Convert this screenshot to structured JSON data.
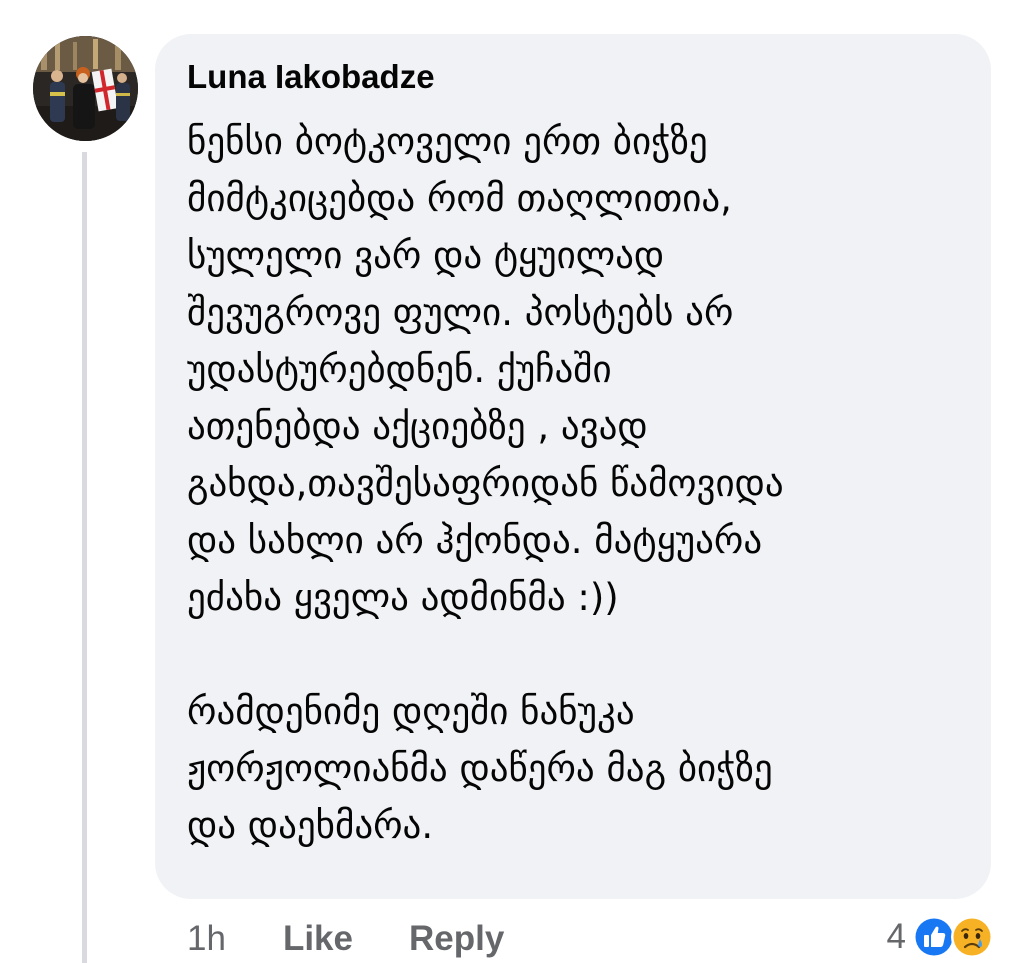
{
  "comment": {
    "author": "Luna Iakobadze",
    "lines": [
      "ნენსი  ბოტკოველი  ერთ ბიჭზე",
      "მიმტკიცებდა რომ თაღლითია,",
      "სულელი ვარ და ტყუილად",
      "შევუგროვე ფული. პოსტებს არ",
      "უდასტურებდნენ. ქუჩაში",
      "ათენებდა აქციებზე , ავად",
      "გახდა,თავშესაფრიდან წამოვიდა",
      "და  სახლი არ ჰქონდა. მატყუარა",
      "ეძახა ყველა ადმინმა :))",
      "",
      "რამდენიმე დღეში ნანუკა",
      "ჟორჟოლიანმა დაწერა მაგ ბიჭზე",
      "და დაეხმარა."
    ],
    "time": "1h",
    "like_label": "Like",
    "reply_label": "Reply",
    "reaction_count": "4",
    "reactions": [
      "like-icon",
      "sad-icon"
    ]
  },
  "colors": {
    "bubble": "#f0f2f5",
    "text": "#050505",
    "secondary_text": "#65676b",
    "like_blue": "#1877f2",
    "sad_yellow": "#f7b125",
    "thread_line": "#d9dadf"
  }
}
